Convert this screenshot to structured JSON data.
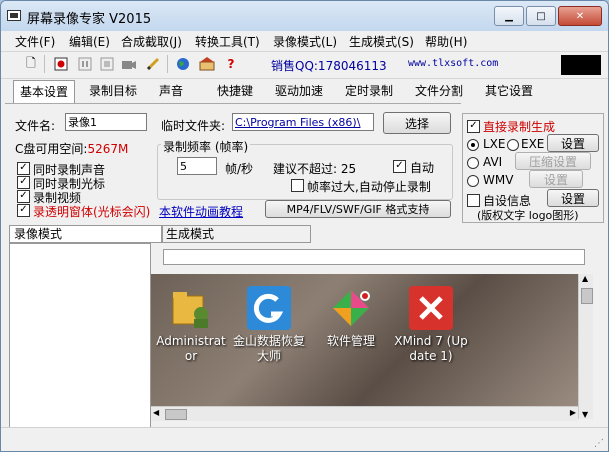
{
  "window": {
    "title": "屏幕录像专家 V2015"
  },
  "menu": [
    "文件(F)",
    "编辑(E)",
    "合成截取(J)",
    "转换工具(T)",
    "录像模式(L)",
    "生成模式(S)",
    "帮助(H)"
  ],
  "toolbar": {
    "icons": [
      "new-file-icon",
      "record-icon",
      "pause-icon",
      "pause-icon-2",
      "stop-icon",
      "camera-icon",
      "pencil-icon",
      "globe-icon",
      "shop-icon",
      "help-icon"
    ],
    "qq_text": "销售QQ:178046113",
    "url_text": "www.tlxsoft.com"
  },
  "tabs": [
    "基本设置",
    "录制目标",
    "声音",
    "快捷键",
    "驱动加速",
    "定时录制",
    "文件分割",
    "其它设置"
  ],
  "basic": {
    "filename_label": "文件名:",
    "filename_value": "录像1",
    "tempdir_label": "临时文件夹:",
    "tempdir_value": "C:\\Program Files (x86)\\",
    "browse_button": "选择",
    "disk_label": "C盘可用空间:",
    "disk_value": "5267M",
    "chk_record_audio": "同时录制声音",
    "chk_record_cursor": "同时录制光标",
    "chk_record_video": "录制视频",
    "chk_transparent": "录透明窗体(光标会闪)",
    "anim_tutorial_link": "本软件动画教程",
    "fps_group_label": "录制频率 (帧率)",
    "fps_value": "5",
    "fps_unit": "帧/秒",
    "fps_suggest": "建议不超过: 25",
    "auto_label": "自动",
    "auto_stop_label": "帧率过大,自动停止录制",
    "format_button": "MP4/FLV/SWF/GIF 格式支持"
  },
  "right_panel": {
    "direct_label": "直接录制生成",
    "lxe_label": "LXE",
    "exe_label": "EXE",
    "settings_button": "设置",
    "avi_label": "AVI",
    "compress_button": "压缩设置",
    "wmv_label": "WMV",
    "settings_button2": "设置",
    "auto_info_label": "自设信息",
    "settings_button3": "设置",
    "copyright_label": "(版权文字 logo图形)"
  },
  "lower_tabs": [
    "录像模式",
    "生成模式"
  ],
  "desktop_icons": [
    {
      "label": "Administrat or",
      "icon": "folder-user-icon",
      "color": "#e0b040"
    },
    {
      "label": "金山数据恢复 大师",
      "icon": "recovery-icon",
      "color": "#2c8ad8"
    },
    {
      "label": "软件管理",
      "icon": "software-manager-icon",
      "color": "#d04a8a"
    },
    {
      "label": "XMind 7 (Up date 1)",
      "icon": "xmind-icon",
      "color": "#d8322c"
    }
  ],
  "colors": {
    "red": "#d00000",
    "blue": "#0000a0",
    "accent": "#2a5ea8"
  }
}
